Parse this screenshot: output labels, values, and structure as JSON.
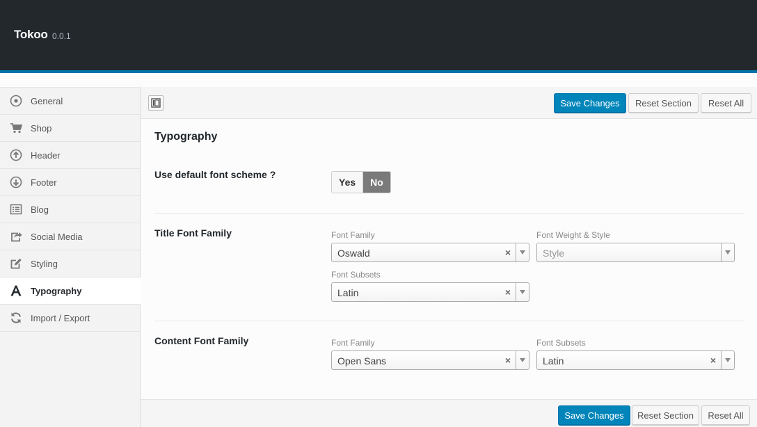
{
  "app": {
    "title": "Tokoo",
    "version": "0.0.1"
  },
  "sidebar": {
    "items": [
      {
        "label": "General",
        "icon": "general-icon"
      },
      {
        "label": "Shop",
        "icon": "cart-icon"
      },
      {
        "label": "Header",
        "icon": "arrow-up-circle-icon"
      },
      {
        "label": "Footer",
        "icon": "arrow-down-circle-icon"
      },
      {
        "label": "Blog",
        "icon": "list-icon"
      },
      {
        "label": "Social Media",
        "icon": "share-icon"
      },
      {
        "label": "Styling",
        "icon": "edit-icon"
      },
      {
        "label": "Typography",
        "icon": "font-icon",
        "active": true
      },
      {
        "label": "Import / Export",
        "icon": "refresh-icon"
      }
    ]
  },
  "toolbar": {
    "save_label": "Save Changes",
    "reset_section_label": "Reset Section",
    "reset_all_label": "Reset All"
  },
  "section": {
    "title": "Typography",
    "default_font": {
      "label": "Use default font scheme ?",
      "yes_label": "Yes",
      "no_label": "No",
      "selected": "No"
    },
    "title_font": {
      "label": "Title Font Family",
      "family_label": "Font Family",
      "family_value": "Oswald",
      "weight_label": "Font Weight & Style",
      "weight_placeholder": "Style",
      "subsets_label": "Font Subsets",
      "subsets_value": "Latin"
    },
    "content_font": {
      "label": "Content Font Family",
      "family_label": "Font Family",
      "family_value": "Open Sans",
      "subsets_label": "Font Subsets",
      "subsets_value": "Latin"
    }
  },
  "footer": {
    "save_label": "Save Changes",
    "reset_section_label": "Reset Section",
    "reset_all_label": "Reset All"
  },
  "colors": {
    "header_bg": "#23282d",
    "accent": "#0073aa",
    "primary_button": "#0085ba",
    "toggle_on": "#7a7a7a"
  }
}
